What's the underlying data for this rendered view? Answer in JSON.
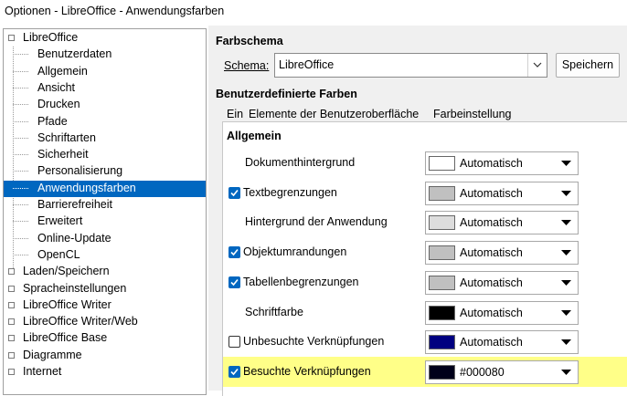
{
  "window": {
    "title": "Optionen - LibreOffice - Anwendungsfarben"
  },
  "tree": {
    "items": [
      {
        "label": "LibreOffice",
        "level": 0
      },
      {
        "label": "Benutzerdaten",
        "level": 1
      },
      {
        "label": "Allgemein",
        "level": 1
      },
      {
        "label": "Ansicht",
        "level": 1
      },
      {
        "label": "Drucken",
        "level": 1
      },
      {
        "label": "Pfade",
        "level": 1
      },
      {
        "label": "Schriftarten",
        "level": 1
      },
      {
        "label": "Sicherheit",
        "level": 1
      },
      {
        "label": "Personalisierung",
        "level": 1
      },
      {
        "label": "Anwendungsfarben",
        "level": 1,
        "selected": true
      },
      {
        "label": "Barrierefreiheit",
        "level": 1
      },
      {
        "label": "Erweitert",
        "level": 1
      },
      {
        "label": "Online-Update",
        "level": 1
      },
      {
        "label": "OpenCL",
        "level": 1
      },
      {
        "label": "Laden/Speichern",
        "level": 0
      },
      {
        "label": "Spracheinstellungen",
        "level": 0
      },
      {
        "label": "LibreOffice Writer",
        "level": 0
      },
      {
        "label": "LibreOffice Writer/Web",
        "level": 0
      },
      {
        "label": "LibreOffice Base",
        "level": 0
      },
      {
        "label": "Diagramme",
        "level": 0
      },
      {
        "label": "Internet",
        "level": 0
      }
    ]
  },
  "scheme": {
    "section_title": "Farbschema",
    "label": "Schema:",
    "value": "LibreOffice",
    "save_label": "Speichern"
  },
  "custom": {
    "section_title": "Benutzerdefinierte Farben",
    "columns": {
      "on": "Ein",
      "element": "Elemente der Benutzeroberfläche",
      "setting": "Farbeinstellung"
    },
    "group_title": "Allgemein",
    "rows": [
      {
        "label": "Dokumenthintergrund",
        "checkbox": false,
        "color_label": "Automatisch",
        "swatch": "#ffffff"
      },
      {
        "label": "Textbegrenzungen",
        "checkbox": true,
        "checked": true,
        "color_label": "Automatisch",
        "swatch": "#c0c0c0"
      },
      {
        "label": "Hintergrund der Anwendung",
        "checkbox": false,
        "color_label": "Automatisch",
        "swatch": "#dddddd"
      },
      {
        "label": "Objektumrandungen",
        "checkbox": true,
        "checked": true,
        "color_label": "Automatisch",
        "swatch": "#c0c0c0"
      },
      {
        "label": "Tabellenbegrenzungen",
        "checkbox": true,
        "checked": true,
        "color_label": "Automatisch",
        "swatch": "#c0c0c0"
      },
      {
        "label": "Schriftfarbe",
        "checkbox": false,
        "color_label": "Automatisch",
        "swatch": "#000000"
      },
      {
        "label": "Unbesuchte Verknüpfungen",
        "checkbox": true,
        "checked": false,
        "color_label": "Automatisch",
        "swatch": "#000080"
      },
      {
        "label": "Besuchte Verknüpfungen",
        "checkbox": true,
        "checked": true,
        "color_label": "#000080",
        "swatch": "#00001a",
        "highlight": true
      }
    ]
  },
  "colors": {
    "accent": "#0067c0",
    "highlight": "#ffff88"
  }
}
